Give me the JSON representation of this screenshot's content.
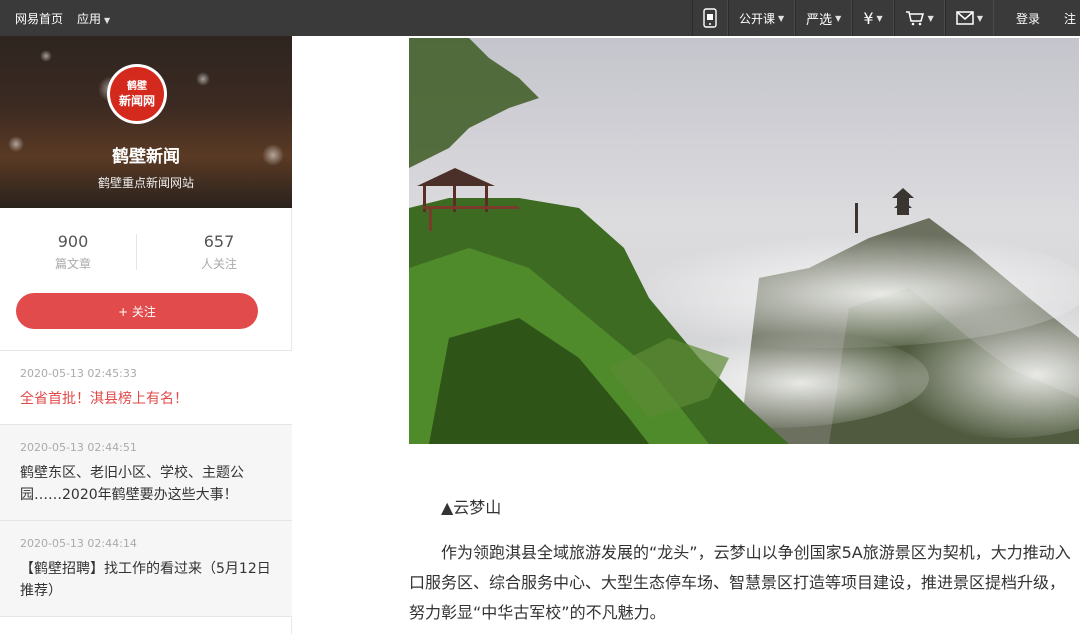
{
  "topbar": {
    "home_link": "网易首页",
    "apps_label": "应用",
    "public_course": "公开课",
    "yanxuan": "严选",
    "login": "登录",
    "register": "注"
  },
  "sidebar": {
    "logo_text_top": "鹤壁",
    "logo_text_bottom": "新闻网",
    "site_name": "鹤壁新闻",
    "site_desc": "鹤壁重点新闻网站",
    "stats": [
      {
        "num": "900",
        "label": "篇文章"
      },
      {
        "num": "657",
        "label": "人关注"
      }
    ],
    "follow_label": "+ 关注",
    "items": [
      {
        "date": "2020-05-13 02:45:33",
        "title": "全省首批！淇县榜上有名！"
      },
      {
        "date": "2020-05-13 02:44:51",
        "title": "鹤壁东区、老旧小区、学校、主题公园……2020年鹤壁要办这些大事！"
      },
      {
        "date": "2020-05-13 02:44:14",
        "title": "【鹤壁招聘】找工作的看过来（5月12日推荐）"
      }
    ]
  },
  "article": {
    "caption": "▲云梦山",
    "paragraph": "作为领跑淇县全域旅游发展的“龙头”，云梦山以争创国家5A旅游景区为契机，大力推动入口服务区、综合服务中心、大型生态停车场、智慧景区打造等项目建设，推进景区提档升级，努力彰显“中华古军校”的不凡魅力。"
  },
  "colors": {
    "topbar_bg": "#3a3a3a",
    "accent_red": "#e14b4b"
  }
}
